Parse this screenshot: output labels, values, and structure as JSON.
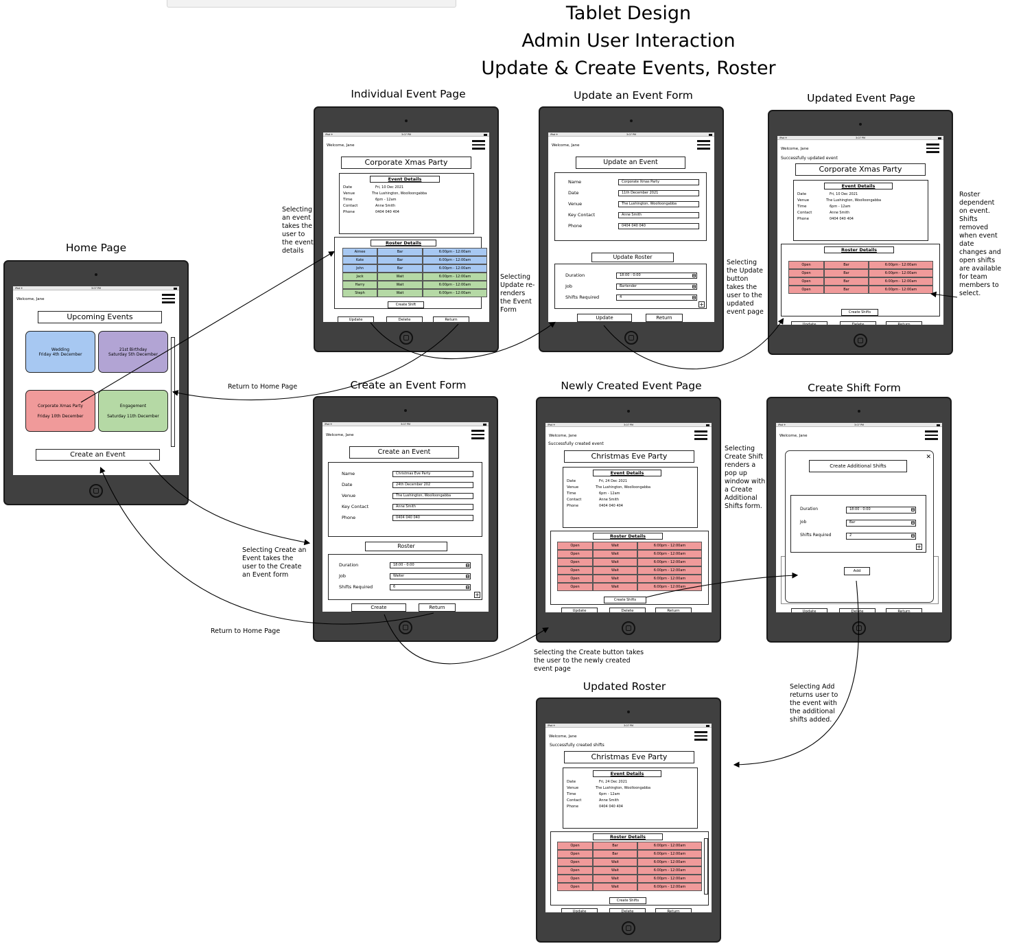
{
  "titles": [
    "Tablet Design",
    "Admin User Interaction",
    "Update & Create Events, Roster"
  ],
  "status": {
    "left": "iPad ✈",
    "center": "3:07 PM"
  },
  "welcome": "Welcome, Jane",
  "home": {
    "screen_title": "Home Page",
    "header": "Upcoming Events",
    "cards": [
      {
        "name": "Wedding",
        "date": "Friday 4th December",
        "color": "#a7c8f2"
      },
      {
        "name": "21st Birthday",
        "date": "Saturday 5th December",
        "color": "#b2a4d4"
      },
      {
        "name": "Corporate Xmas Party",
        "date": "Friday 10th December",
        "color": "#f09a9a"
      },
      {
        "name": "Engagement",
        "date": "Saturday 11th December",
        "color": "#b5d9a5"
      }
    ],
    "create_button": "Create an Event"
  },
  "common": {
    "event_details": "Event Details",
    "roster_details": "Roster Details",
    "update": "Update",
    "delete": "Delete",
    "return": "Return",
    "create": "Create",
    "create_shift": "Create Shift",
    "create_shifts": "Create Shifts",
    "add": "Add",
    "detail_labels": [
      "Date",
      "Venue",
      "Time",
      "Contact",
      "Phone"
    ],
    "form_labels": [
      "Name",
      "Date",
      "Venue",
      "Key Contact",
      "Phone"
    ],
    "roster_labels": [
      "Duration",
      "Job",
      "Shifts Required"
    ]
  },
  "event": {
    "screen_title": "Individual Event Page",
    "name": "Corporate Xmas Party",
    "details": [
      "Fri, 10 Dec 2021",
      "The Lushington, Woolloongabba",
      "6pm - 12am",
      "Anne Smith",
      "0404 040 404"
    ],
    "roster": [
      {
        "name": "Aimee",
        "job": "Bar",
        "time": "6:00pm - 12:00am",
        "color": "#a7c8f2"
      },
      {
        "name": "Kate",
        "job": "Bar",
        "time": "6:00pm - 12:00am",
        "color": "#a7c8f2"
      },
      {
        "name": "John",
        "job": "Bar",
        "time": "6:00pm - 12:00am",
        "color": "#a7c8f2"
      },
      {
        "name": "Jack",
        "job": "Wait",
        "time": "6:00pm - 12:00am",
        "color": "#b5d9a5"
      },
      {
        "name": "Harry",
        "job": "Wait",
        "time": "6:00pm - 12:00am",
        "color": "#b5d9a5"
      },
      {
        "name": "Steph",
        "job": "Wait",
        "time": "6:00pm - 12:00am",
        "color": "#b5d9a5"
      }
    ]
  },
  "update_form": {
    "screen_title": "Update an Event Form",
    "header": "Update an Event",
    "values": [
      "Corporate Xmas Party",
      "11th December 2021",
      "The Lushington, Woolloongabba",
      "Anne Smith",
      "0404 040 040"
    ],
    "roster_header": "Update Roster",
    "roster_values": [
      "18:00 - 0:00",
      "Bartender",
      "4"
    ]
  },
  "updated": {
    "screen_title": "Updated Event Page",
    "message": "Successfully updated event",
    "name": "Corporate Xmas Party",
    "details": [
      "Fri, 10 Dec 2021",
      "The Lushington, Woolloongabba",
      "6pm - 12am",
      "Anne Smith",
      "0404 040 404"
    ],
    "roster": [
      {
        "name": "Open",
        "job": "Bar",
        "time": "6:00pm - 12:00am"
      },
      {
        "name": "Open",
        "job": "Bar",
        "time": "6:00pm - 12:00am"
      },
      {
        "name": "Open",
        "job": "Bar",
        "time": "6:00pm - 12:00am"
      },
      {
        "name": "Open",
        "job": "Bar",
        "time": "6:00pm - 12:00am"
      }
    ]
  },
  "create_form": {
    "screen_title": "Create an Event Form",
    "header": "Create an Event",
    "values": [
      "Christmas Eve Party",
      "24th December 202",
      "The Lushington, Woolloongabba",
      "Anne Smith",
      "0404 040 040"
    ],
    "roster_header": "Roster",
    "roster_values": [
      "18:00 - 0:00",
      "Waiter",
      "6"
    ]
  },
  "new_event": {
    "screen_title": "Newly Created Event Page",
    "message": "Successfully created event",
    "name": "Christmas Eve Party",
    "details": [
      "Fri, 24 Dec 2021",
      "The Lushington, Woolloongabba",
      "6pm - 12am",
      "Anne Smith",
      "0404 040 404"
    ],
    "roster": [
      {
        "name": "Open",
        "job": "Wait",
        "time": "6:00pm - 12:00am"
      },
      {
        "name": "Open",
        "job": "Wait",
        "time": "6:00pm - 12:00am"
      },
      {
        "name": "Open",
        "job": "Wait",
        "time": "6:00pm - 12:00am"
      },
      {
        "name": "Open",
        "job": "Wait",
        "time": "6:00pm - 12:00am"
      },
      {
        "name": "Open",
        "job": "Wait",
        "time": "6:00pm - 12:00am"
      },
      {
        "name": "Open",
        "job": "Wait",
        "time": "6:00pm - 12:00am"
      }
    ]
  },
  "shift_form": {
    "screen_title": "Create Shift Form",
    "header": "Create Additional Shifts",
    "values": [
      "18:00 - 0:00",
      "Bar",
      "2"
    ],
    "close": "✕"
  },
  "updated_roster": {
    "screen_title": "Updated Roster",
    "message": "Successfully created shifts",
    "name": "Christmas Eve Party",
    "details": [
      "Fri, 24 Dec 2021",
      "The Lushington, Woolloongabba",
      "6pm - 12am",
      "Anne Smith",
      "0404 040 404"
    ],
    "roster": [
      {
        "name": "Open",
        "job": "Bar",
        "time": "6:00pm - 12:00am"
      },
      {
        "name": "Open",
        "job": "Bar",
        "time": "6:00pm - 12:00am"
      },
      {
        "name": "Open",
        "job": "Wait",
        "time": "6:00pm - 12:00am"
      },
      {
        "name": "Open",
        "job": "Wait",
        "time": "6:00pm - 12:00am"
      },
      {
        "name": "Open",
        "job": "Wait",
        "time": "6:00pm - 12:00am"
      },
      {
        "name": "Open",
        "job": "Wait",
        "time": "6:00pm - 12:00am"
      }
    ]
  },
  "notes": {
    "select_event": "Selecting an event takes the user to the event details",
    "select_update": "Selecting Update re-renders the Event Form",
    "update_button": "Selecting the Update button takes the user to the updated event page",
    "roster_dependent": "Roster dependent on event. Shifts removed when event date changes and open shifts are available for team members to select.",
    "return_home_1": "Return to Home Page",
    "return_home_2": "Return to Home Page",
    "select_create": "Selecting Create an Event takes the user to the Create an Event form",
    "create_button": "Selecting the Create button takes the user to the newly created event page",
    "create_shift": "Selecting Create Shift renders a pop up window with a Create Additional Shifts form.",
    "select_add": "Selecting Add returns user to the event with the additional shifts added."
  },
  "colors": {
    "open_shift": "#f09a9a",
    "bar_shift": "#a7c8f2",
    "wait_shift": "#b5d9a5",
    "tablet": "#404040"
  }
}
